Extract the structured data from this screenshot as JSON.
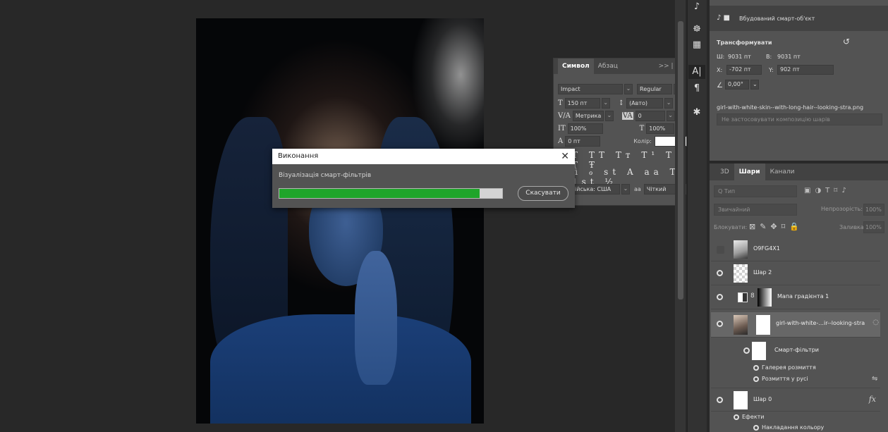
{
  "character_panel": {
    "tabs": [
      "Символ",
      "Абзац"
    ],
    "font_family": "Impact",
    "font_style": "Regular",
    "size": "150 пт",
    "leading": "(Авто)",
    "kerning": "Метрика",
    "tracking": "0",
    "vertical_scale": "100%",
    "horizontal_scale": "100%",
    "baseline_shift": "0 пт",
    "color_label": "Колір:",
    "color_value": "#ffffff",
    "glyph_row_1": "T TT Tт T¹ T₁ T Ŧ",
    "glyph_row_2": "ﬁ ℴ st A aa T 1st ½",
    "language": "Англійська: США",
    "antialias_icon": "aa",
    "antialias": "Чіткий"
  },
  "progress_dialog": {
    "title": "Виконання",
    "message": "Візуалізація смарт-фільтрів",
    "progress": 0.9,
    "cancel_label": "Скасувати"
  },
  "properties_panel": {
    "header": "Вбудований смарт-об'єкт",
    "section": "Трансформувати",
    "w_label": "Ш:",
    "w_value": "9031 пт",
    "h_label": "В:",
    "h_value": "9031 пт",
    "x_label": "X:",
    "x_value": "-702 пт",
    "y_label": "Y:",
    "y_value": "902 пт",
    "angle": "0,00°",
    "filename": "girl-with-white-skin--with-long-hair--looking-stra.png",
    "composition": "Не застосовувати композицію шарів"
  },
  "layers_panel": {
    "tabs": [
      "3D",
      "Шари",
      "Канали"
    ],
    "search_placeholder": "Q Тип",
    "blend_mode": "Звичайний",
    "opacity_label": "Непрозорість:",
    "opacity_value": "100%",
    "lock_label": "Блокувати:",
    "fill_label": "Заливка:",
    "fill_value": "100%",
    "layers": [
      {
        "name": "O9FG4X1"
      },
      {
        "name": "Шар 2"
      },
      {
        "name": "Мапа градієнта 1"
      },
      {
        "name": "girl-with-white-...ir--looking-stra"
      },
      {
        "name": "Смарт-фільтри"
      },
      {
        "name": "Шар 0"
      }
    ],
    "filters": [
      "Галерея розмиття",
      "Розмиття у русі"
    ],
    "effects_label": "Ефекти",
    "effect_items": [
      "Накладання кольору"
    ]
  },
  "colors": {
    "progress_fill": "#1fa52a",
    "panel_bg": "#535353",
    "workspace_bg": "#282828"
  },
  "icons": [
    "close-icon",
    "eye-icon",
    "fx-icon",
    "link-icon",
    "rotate-icon",
    "3d-icon",
    "character-icon",
    "paragraph-icon",
    "gear-icon"
  ]
}
